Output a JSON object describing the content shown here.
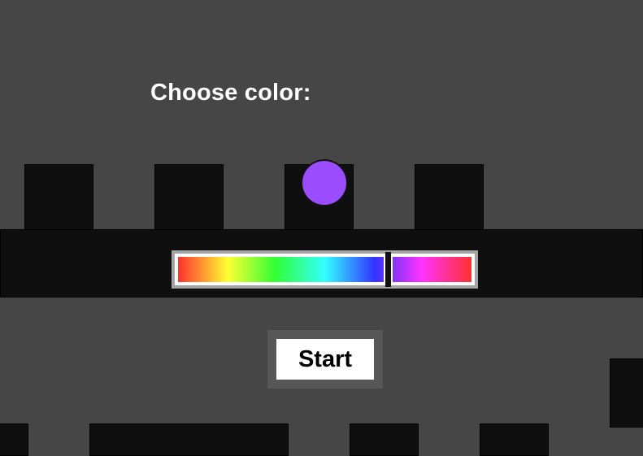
{
  "title": "Choose color:",
  "selected_color": "#9a4dff",
  "hue_slider": {
    "value_fraction": 0.71
  },
  "start_button": {
    "label": "Start"
  },
  "colors": {
    "background": "#464646",
    "wall": "#0f0f0f",
    "button_bg": "#ffffff",
    "button_frame": "#575757",
    "slider_frame": "#a4a4a4"
  }
}
